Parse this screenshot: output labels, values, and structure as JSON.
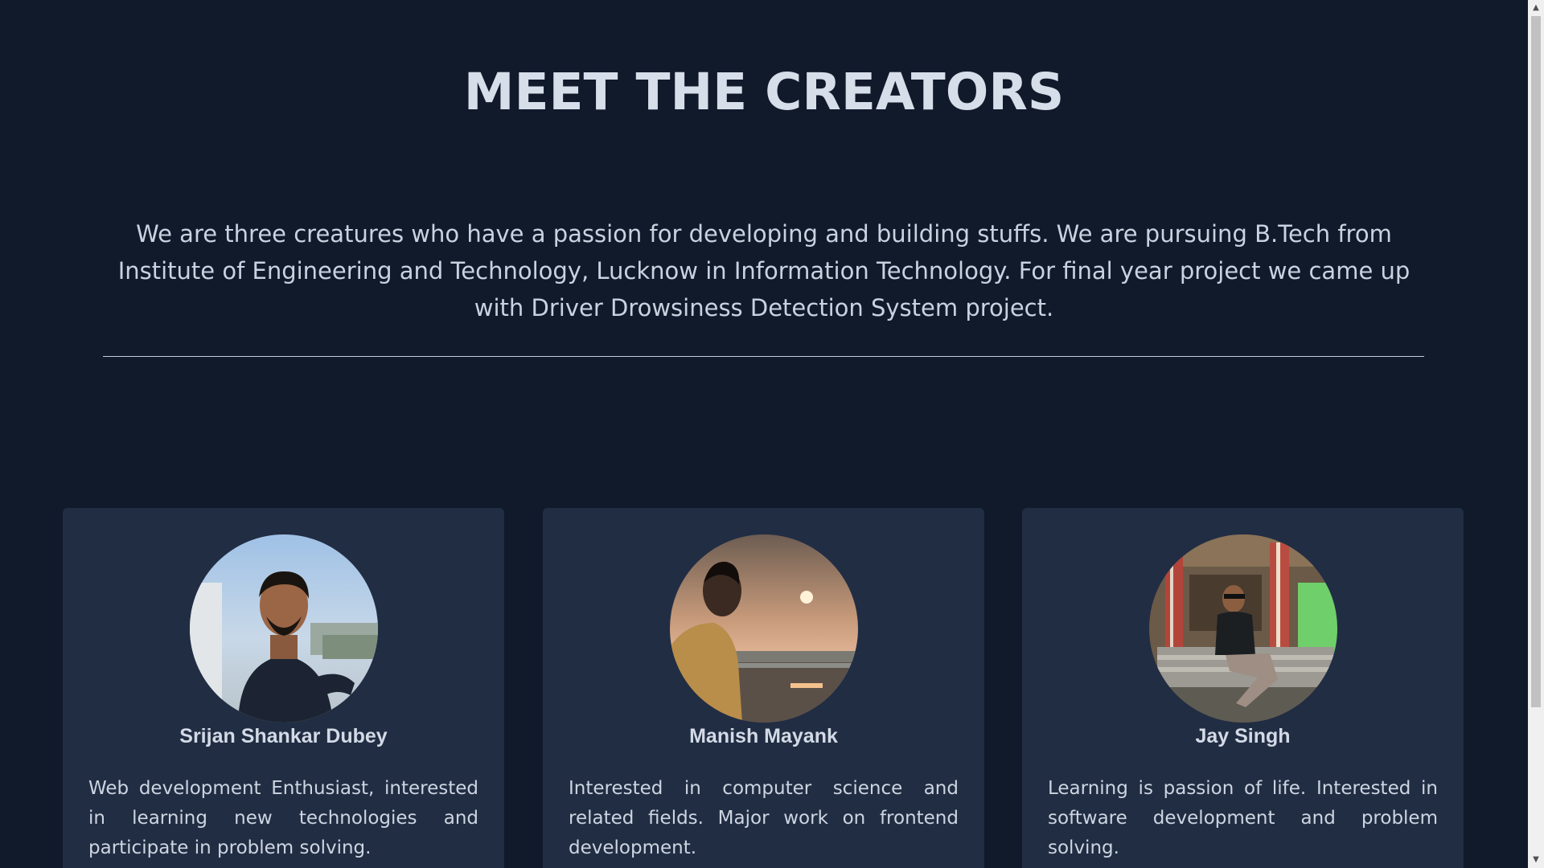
{
  "header": {
    "title": "MEET THE CREATORS",
    "intro": "We are three creatures who have a passion for developing and building stuffs. We are pursuing B.Tech from Institute of Engineering and Technology, Lucknow in Information Technology. For final year project we came up with Driver Drowsiness Detection System project."
  },
  "creators": [
    {
      "name": "Srijan Shankar Dubey",
      "bio": "Web development Enthusiast, interested in learning new technologies and participate in problem solving.",
      "avatar_icon": "person-photo-icon"
    },
    {
      "name": "Manish Mayank",
      "bio": "Interested in computer science and related fields. Major work on frontend development.",
      "avatar_icon": "person-photo-icon"
    },
    {
      "name": "Jay Singh",
      "bio": "Learning is passion of life. Interested in software development and problem solving.",
      "avatar_icon": "person-photo-icon"
    }
  ],
  "colors": {
    "background": "#111a2b",
    "card": "#212d43",
    "text": "#d5dbe6"
  },
  "scrollbar": {
    "up_arrow": "▲",
    "down_arrow": "▼"
  }
}
